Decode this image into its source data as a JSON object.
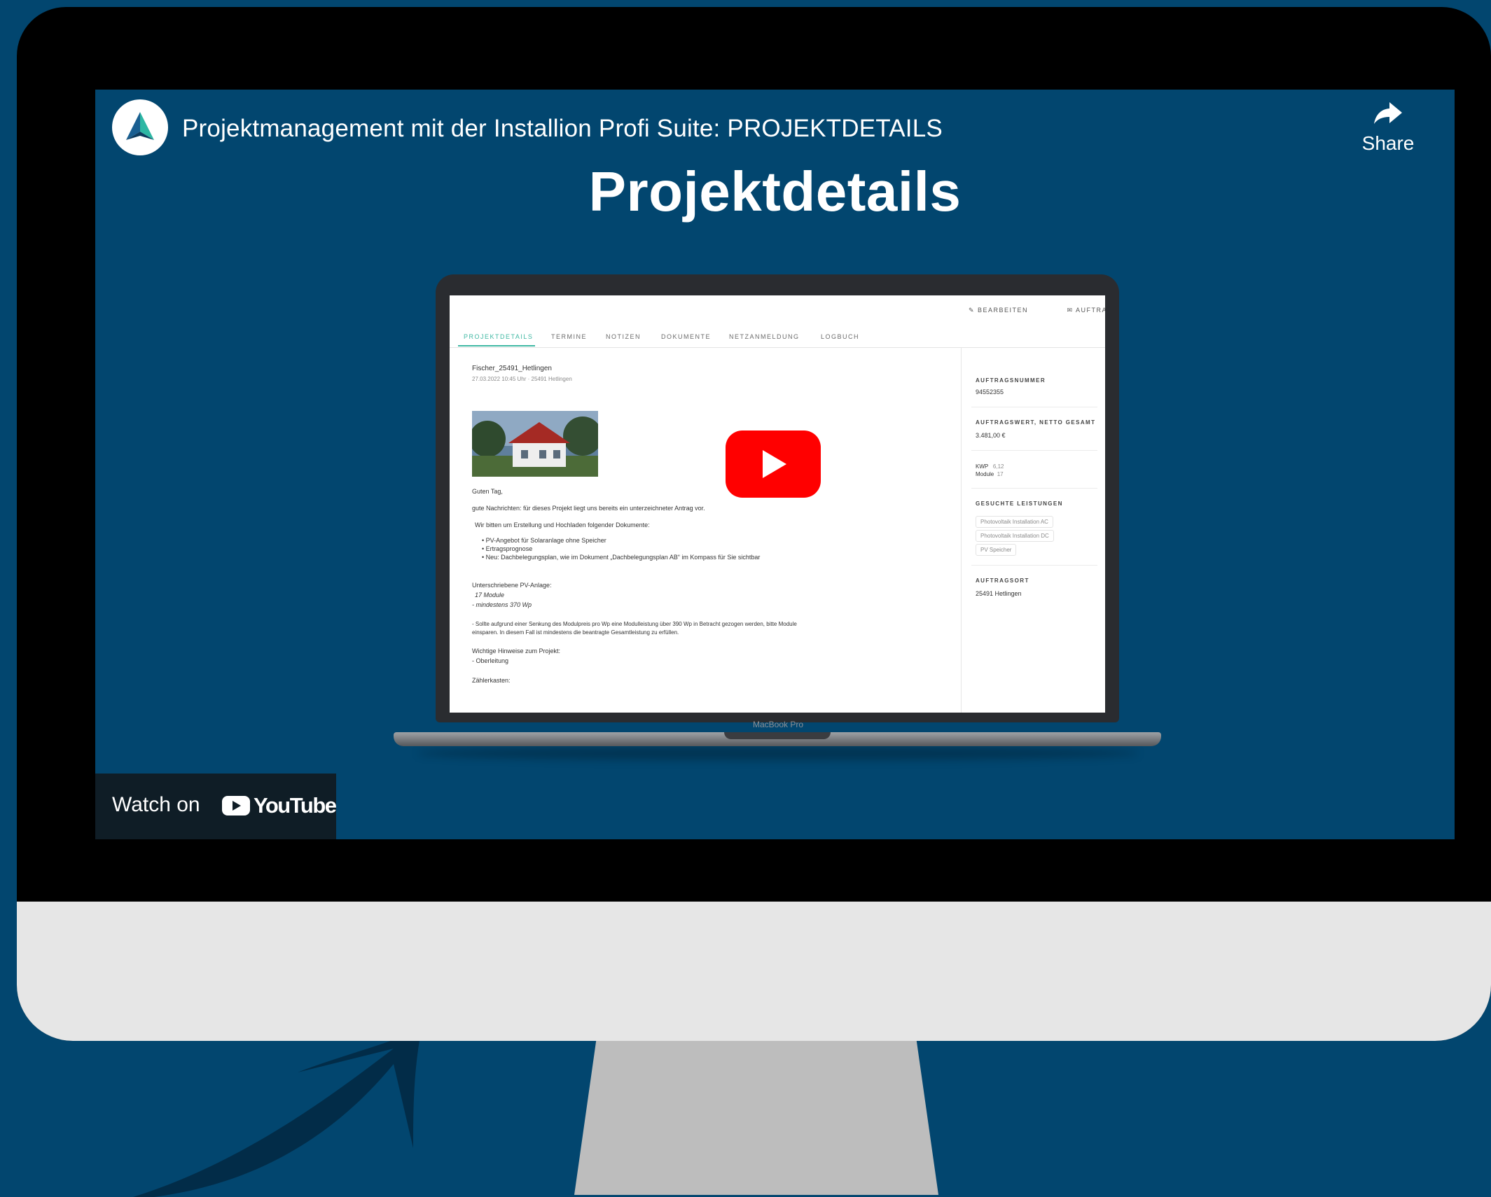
{
  "video": {
    "title": "Projektmanagement mit der Installion Profi Suite: PROJEKTDETAILS",
    "share_label": "Share",
    "heading": "Projektdetails",
    "watch_on_label": "Watch on",
    "youtube_wordmark": "YouTube"
  },
  "laptop": {
    "brand": "MacBook Pro",
    "toolbar": {
      "edit": "BEARBEITEN",
      "order": "AUFTRAG AB"
    },
    "tabs": [
      "PROJEKTDETAILS",
      "TERMINE",
      "NOTIZEN",
      "DOKUMENTE",
      "NETZANMELDUNG",
      "LOGBUCH"
    ],
    "project": {
      "name": "Fischer_25491_Hetlingen",
      "meta": "27.03.2022 10:45 Uhr · 25491 Hetlingen",
      "greeting": "Guten Tag,",
      "intro": "gute Nachrichten: für dieses Projekt liegt uns bereits ein unterzeichneter Antrag vor.",
      "request": "Wir bitten um Erstellung und Hochladen folgender Dokumente:",
      "bullets": [
        "PV-Angebot für Solaranlage ohne Speicher",
        "Ertragsprognose",
        "Neu: Dachbelegungsplan, wie im Dokument „Dachbelegungsplan AB“ im Kompass für Sie sichtbar"
      ],
      "system_heading": "Unterschriebene PV-Anlage:",
      "system_lines": [
        "17 Module",
        "- mindestens 370 Wp"
      ],
      "note_1": "- Sollte aufgrund einer Senkung des Modulpreis pro Wp eine Modulleistung über 390 Wp in Betracht gezogen werden, bitte Module",
      "note_2": "einsparen. In diesem Fall ist mindestens die beantragte Gesamtleistung zu erfüllen.",
      "hints_heading": "Wichtige Hinweise zum Projekt:",
      "hints_line": "- Oberleitung",
      "meter_heading": "Zählerkasten:"
    },
    "sidebar": {
      "order_number_label": "AUFTRAGSNUMMER",
      "order_number": "94552355",
      "order_value_label": "AUFTRAGSWERT, NETTO GESAMT",
      "order_value": "3.481,00 €",
      "kwp_label": "KWP",
      "kwp_value": "6,12",
      "modules_label": "Module",
      "modules_value": "17",
      "services_label": "GESUCHTE LEISTUNGEN",
      "services": [
        "Photovoltaik Installation AC",
        "Photovoltaik Installation DC",
        "PV Speicher"
      ],
      "location_label": "AUFTRAGSORT",
      "location": "25491 Hetlingen"
    }
  },
  "colors": {
    "background": "#02466f",
    "accent_tab": "#3fb8a3",
    "play_red": "#ff0000"
  }
}
